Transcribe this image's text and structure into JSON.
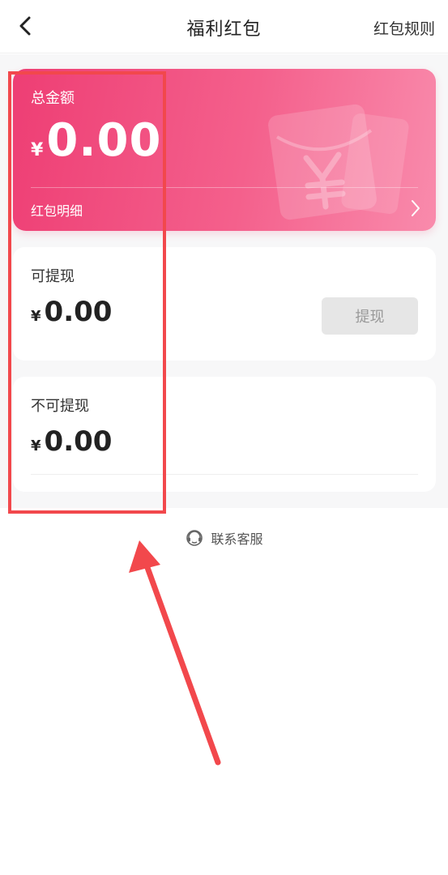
{
  "header": {
    "title": "福利红包",
    "rules_label": "红包规则"
  },
  "total_card": {
    "label": "总金额",
    "currency": "¥",
    "amount": "0.00",
    "detail_label": "红包明细"
  },
  "withdrawable": {
    "label": "可提现",
    "currency": "¥",
    "amount": "0.00",
    "button_label": "提现"
  },
  "non_withdrawable": {
    "label": "不可提现",
    "currency": "¥",
    "amount": "0.00"
  },
  "service": {
    "label": "联系客服"
  },
  "icons": {
    "back": "chevron-left-icon",
    "detail": "chevron-right-icon",
    "service": "headset-icon",
    "decoration": "red-envelope-icon"
  },
  "colors": {
    "card_gradient_start": "#ee3e74",
    "card_gradient_end": "#f98bac",
    "annotation": "#f2484c",
    "disabled_button": "#e6e6e6"
  }
}
